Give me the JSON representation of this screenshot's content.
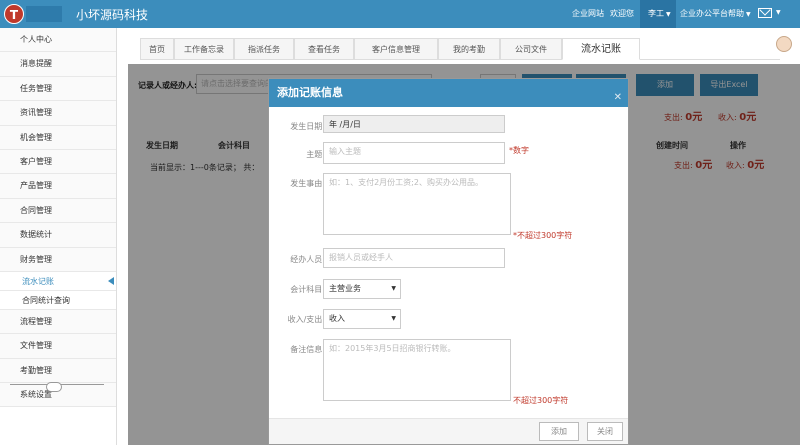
{
  "header": {
    "logo_letter": "T",
    "brand": "小坏源码科技",
    "links": [
      "企业网站",
      "欢迎您"
    ],
    "user_label": "李工",
    "help_label": "企业办公平台帮助"
  },
  "sidebar": {
    "items": [
      "个人中心",
      "消息提醒",
      "任务管理",
      "资讯管理",
      "机会管理",
      "客户管理",
      "产品管理",
      "合同管理",
      "数据统计",
      "财务管理"
    ],
    "sub_items": [
      "流水记账",
      "合同统计查询"
    ],
    "items_after": [
      "流程管理",
      "文件管理",
      "考勤管理",
      "系统设置"
    ]
  },
  "tabs": [
    "首页",
    "工作备忘录",
    "指派任务",
    "查看任务",
    "客户信息管理",
    "我的考勤",
    "公司文件",
    "流水记账"
  ],
  "filter": {
    "label": "记录人或经办人:",
    "placeholder": "请点击选择要查询的",
    "add_label": "添加",
    "export_label": "导出Excel"
  },
  "stats": {
    "expense_label": "支出:",
    "expense_value": "0元",
    "income_label": "收入:",
    "income_value": "0元"
  },
  "table": {
    "headers": [
      "发生日期",
      "会计科目",
      "创建时间",
      "操作"
    ],
    "pager_text": "当前显示：1---0条记录；  共：",
    "summary_expense": "0元",
    "summary_income": "0元"
  },
  "modal": {
    "title": "添加记账信息",
    "close": "✕",
    "date_label": "发生日期:",
    "date_value": "年 /月/日",
    "subject_label": "主题:",
    "subject_placeholder": "输入主题",
    "subject_hint": "*数字",
    "event_label": "发生事由:",
    "event_placeholder": "如：1、支付2月份工资;2、购买办公用品。",
    "event_hint": "*不超过300字符",
    "handler_label": "经办人员:",
    "handler_placeholder": "报销人员或经手人",
    "account_label": "会计科目:",
    "account_value": "主营业务",
    "type_label": "收入/支出:",
    "type_value": "收入",
    "note_label": "备注信息:",
    "note_placeholder": "如：2015年3月5日招商银行转账。",
    "note_hint": "不超过300字符",
    "add_button": "添加",
    "close_button": "关闭"
  }
}
